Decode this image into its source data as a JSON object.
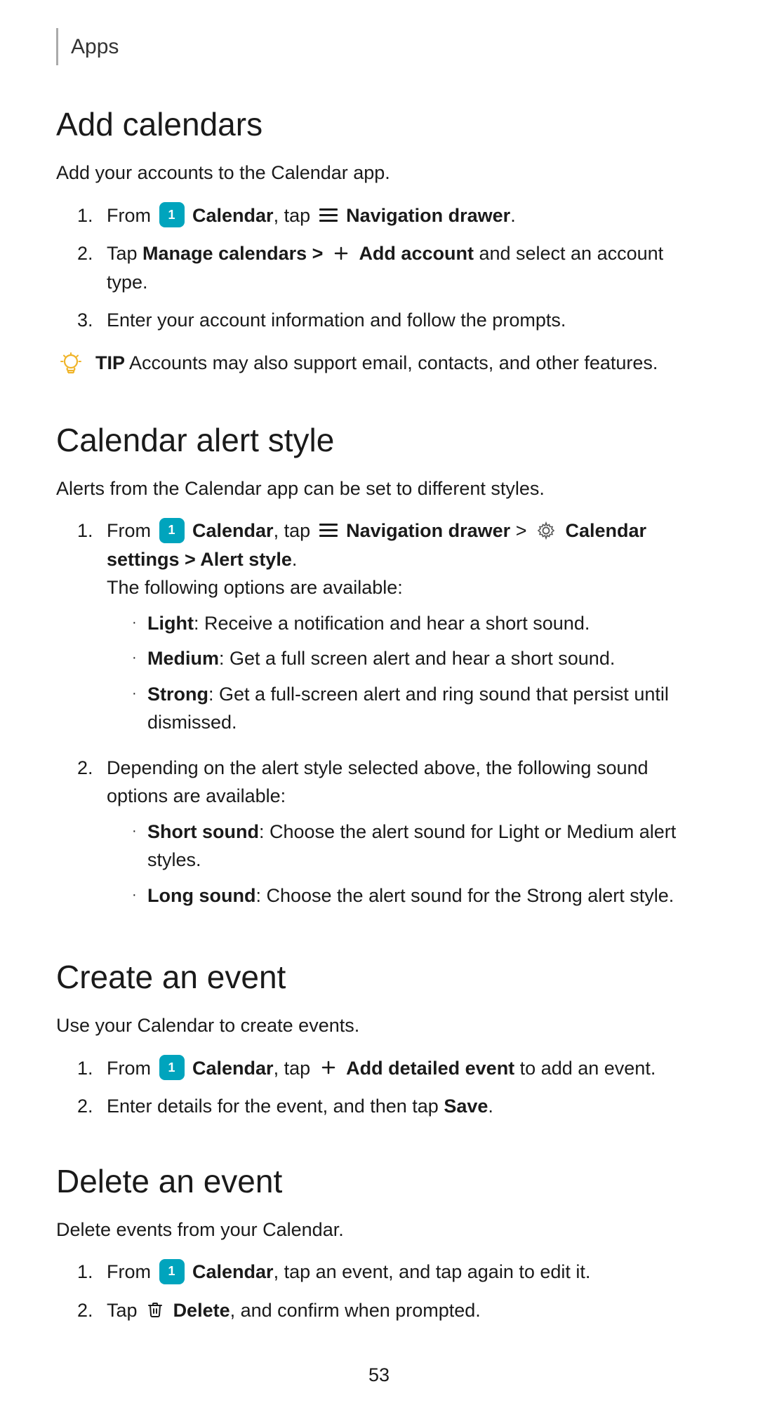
{
  "header": {
    "title": "Apps",
    "divider_color": "#aaaaaa"
  },
  "page_number": "53",
  "sections": [
    {
      "id": "add-calendars",
      "heading": "Add calendars",
      "intro": "Add your accounts to the Calendar app.",
      "steps": [
        {
          "number": "1.",
          "parts": [
            {
              "type": "text",
              "text": "From "
            },
            {
              "type": "calendar-icon"
            },
            {
              "type": "bold",
              "text": " Calendar"
            },
            {
              "type": "text",
              "text": ", tap "
            },
            {
              "type": "menu-icon"
            },
            {
              "type": "bold",
              "text": " Navigation drawer"
            },
            {
              "type": "text",
              "text": "."
            }
          ]
        },
        {
          "number": "2.",
          "parts": [
            {
              "type": "text",
              "text": "Tap "
            },
            {
              "type": "bold",
              "text": "Manage calendars > "
            },
            {
              "type": "plus-icon"
            },
            {
              "type": "bold",
              "text": " Add account"
            },
            {
              "type": "text",
              "text": " and select an account type."
            }
          ]
        },
        {
          "number": "3.",
          "parts": [
            {
              "type": "text",
              "text": "Enter your account information and follow the prompts."
            }
          ]
        }
      ],
      "tip": "Accounts may also support email, contacts, and other features."
    },
    {
      "id": "calendar-alert-style",
      "heading": "Calendar alert style",
      "intro": "Alerts from the Calendar app can be set to different styles.",
      "steps": [
        {
          "number": "1.",
          "parts": [
            {
              "type": "text",
              "text": "From "
            },
            {
              "type": "calendar-icon"
            },
            {
              "type": "bold",
              "text": " Calendar"
            },
            {
              "type": "text",
              "text": ", tap "
            },
            {
              "type": "menu-icon"
            },
            {
              "type": "bold",
              "text": " Navigation drawer"
            },
            {
              "type": "text",
              "text": " > "
            },
            {
              "type": "gear-icon"
            },
            {
              "type": "bold",
              "text": " Calendar settings > Alert style"
            },
            {
              "type": "text",
              "text": "."
            }
          ],
          "sub_text": "The following options are available:",
          "bullets": [
            {
              "bold": "Light",
              "text": ": Receive a notification and hear a short sound."
            },
            {
              "bold": "Medium",
              "text": ": Get a full screen alert and hear a short sound."
            },
            {
              "bold": "Strong",
              "text": ": Get a full-screen alert and ring sound that persist until dismissed."
            }
          ]
        },
        {
          "number": "2.",
          "parts": [
            {
              "type": "text",
              "text": "Depending on the alert style selected above, the following sound options are available:"
            }
          ],
          "bullets": [
            {
              "bold": "Short sound",
              "text": ": Choose the alert sound for Light or Medium alert styles."
            },
            {
              "bold": "Long sound",
              "text": ": Choose the alert sound for the Strong alert style."
            }
          ]
        }
      ]
    },
    {
      "id": "create-an-event",
      "heading": "Create an event",
      "intro": "Use your Calendar to create events.",
      "steps": [
        {
          "number": "1.",
          "parts": [
            {
              "type": "text",
              "text": "From "
            },
            {
              "type": "calendar-icon"
            },
            {
              "type": "bold",
              "text": " Calendar"
            },
            {
              "type": "text",
              "text": ", tap "
            },
            {
              "type": "plus-icon"
            },
            {
              "type": "bold",
              "text": " Add detailed event"
            },
            {
              "type": "text",
              "text": " to add an event."
            }
          ]
        },
        {
          "number": "2.",
          "parts": [
            {
              "type": "text",
              "text": "Enter details for the event, and then tap "
            },
            {
              "type": "bold",
              "text": "Save"
            },
            {
              "type": "text",
              "text": "."
            }
          ]
        }
      ]
    },
    {
      "id": "delete-an-event",
      "heading": "Delete an event",
      "intro": "Delete events from your Calendar.",
      "steps": [
        {
          "number": "1.",
          "parts": [
            {
              "type": "text",
              "text": "From "
            },
            {
              "type": "calendar-icon"
            },
            {
              "type": "bold",
              "text": " Calendar"
            },
            {
              "type": "text",
              "text": ", tap an event, and tap again to edit it."
            }
          ]
        },
        {
          "number": "2.",
          "parts": [
            {
              "type": "text",
              "text": "Tap "
            },
            {
              "type": "trash-icon"
            },
            {
              "type": "bold",
              "text": " Delete"
            },
            {
              "type": "text",
              "text": ", and confirm when prompted."
            }
          ]
        }
      ]
    }
  ]
}
